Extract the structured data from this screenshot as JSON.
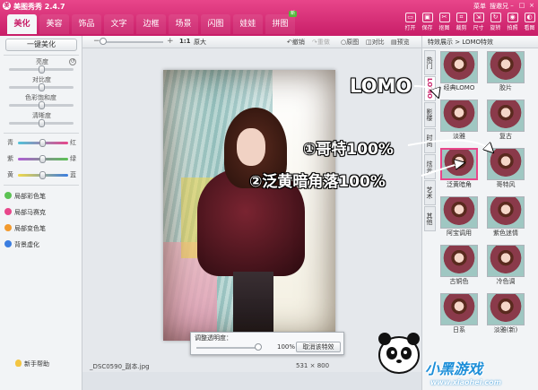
{
  "app": {
    "title": "美图秀秀 2.4.7",
    "menu_label": "菜单",
    "user_label": "搜邀兄",
    "min_icon": "minimize-icon",
    "max_icon": "maximize-icon",
    "close_icon": "close-icon"
  },
  "tabs": [
    {
      "label": "美化",
      "active": true
    },
    {
      "label": "美容",
      "active": false
    },
    {
      "label": "饰品",
      "active": false
    },
    {
      "label": "文字",
      "active": false
    },
    {
      "label": "边框",
      "active": false
    },
    {
      "label": "场景",
      "active": false
    },
    {
      "label": "闪图",
      "active": false
    },
    {
      "label": "娃娃",
      "active": false
    },
    {
      "label": "拼图",
      "active": false,
      "badge": "新"
    }
  ],
  "toolbar": [
    {
      "label": "打开",
      "icon": "folder-icon"
    },
    {
      "label": "保存",
      "icon": "save-icon"
    },
    {
      "label": "抠图",
      "icon": "cutout-icon"
    },
    {
      "label": "裁剪",
      "icon": "crop-icon"
    },
    {
      "label": "尺寸",
      "icon": "resize-icon"
    },
    {
      "label": "旋转",
      "icon": "rotate-icon"
    },
    {
      "label": "拍照",
      "icon": "camera-icon"
    },
    {
      "label": "看图",
      "icon": "view-icon"
    }
  ],
  "left_panel": {
    "one_key_label": "一键美化",
    "sliders": [
      {
        "label": "亮度",
        "value": 0.5
      },
      {
        "label": "对比度",
        "value": 0.5
      },
      {
        "label": "色彩饱和度",
        "value": 0.5
      },
      {
        "label": "清晰度",
        "value": 0.5
      }
    ],
    "color_balance": [
      {
        "left": "青",
        "right": "红",
        "color_from": "#4fc3d9",
        "color_to": "#e8468a",
        "value": 0.5
      },
      {
        "left": "紫",
        "right": "绿",
        "color_from": "#b05cd6",
        "color_to": "#5bc253",
        "value": 0.5
      },
      {
        "left": "黄",
        "right": "蓝",
        "color_from": "#f2d94a",
        "color_to": "#3a7de0",
        "value": 0.5
      }
    ],
    "tools": [
      {
        "label": "局部彩色笔",
        "color": "#5bc253"
      },
      {
        "label": "局部马赛克",
        "color": "#e8468a"
      },
      {
        "label": "局部变色笔",
        "color": "#f29a2e"
      },
      {
        "label": "背景虚化",
        "color": "#3a7de0"
      }
    ],
    "help_label": "新手帮助"
  },
  "canvas": {
    "zoom_minus": "−",
    "zoom_plus": "+",
    "zoom_value": "1:1",
    "zoom_original_label": "原大",
    "undo_label": "撤销",
    "redo_label": "重做",
    "original_label": "原图",
    "compare_label": "对比",
    "preview_label": "预览",
    "opacity_title": "调整透明度：",
    "opacity_value": "100%",
    "cancel_effect_label": "取消该特效",
    "filename": "_DSC0590_副本.jpg",
    "width": "531",
    "times": "×",
    "height": "800"
  },
  "right_panel": {
    "header": "特效展示 > LOMO特效",
    "vtabs": [
      {
        "label": "热门",
        "active": false
      },
      {
        "label": "LOMO",
        "active": true
      },
      {
        "label": "影楼",
        "active": false
      },
      {
        "label": "时尚",
        "active": false
      },
      {
        "label": "炫光",
        "active": false
      },
      {
        "label": "艺术",
        "active": false
      },
      {
        "label": "其他",
        "active": false
      }
    ],
    "effects": [
      {
        "label": "经典LOMO",
        "selected": false
      },
      {
        "label": "胶片",
        "selected": false
      },
      {
        "label": "淡雅",
        "selected": false
      },
      {
        "label": "复古",
        "selected": false
      },
      {
        "label": "泛黄暗角",
        "selected": true
      },
      {
        "label": "哥特风",
        "selected": false
      },
      {
        "label": "阿宝调用",
        "selected": false
      },
      {
        "label": "紫色迷情",
        "selected": false
      },
      {
        "label": "古铜色",
        "selected": false
      },
      {
        "label": "冷色调",
        "selected": false
      },
      {
        "label": "日系",
        "selected": false
      },
      {
        "label": "淡雅(新)",
        "selected": false
      }
    ]
  },
  "annotations": {
    "lomo": "LOMO",
    "step1": "①哥特100%",
    "step2": "②泛黄暗角落100%"
  },
  "watermark": {
    "brand": "小黑游戏",
    "url": "www.xiaohei.com"
  }
}
